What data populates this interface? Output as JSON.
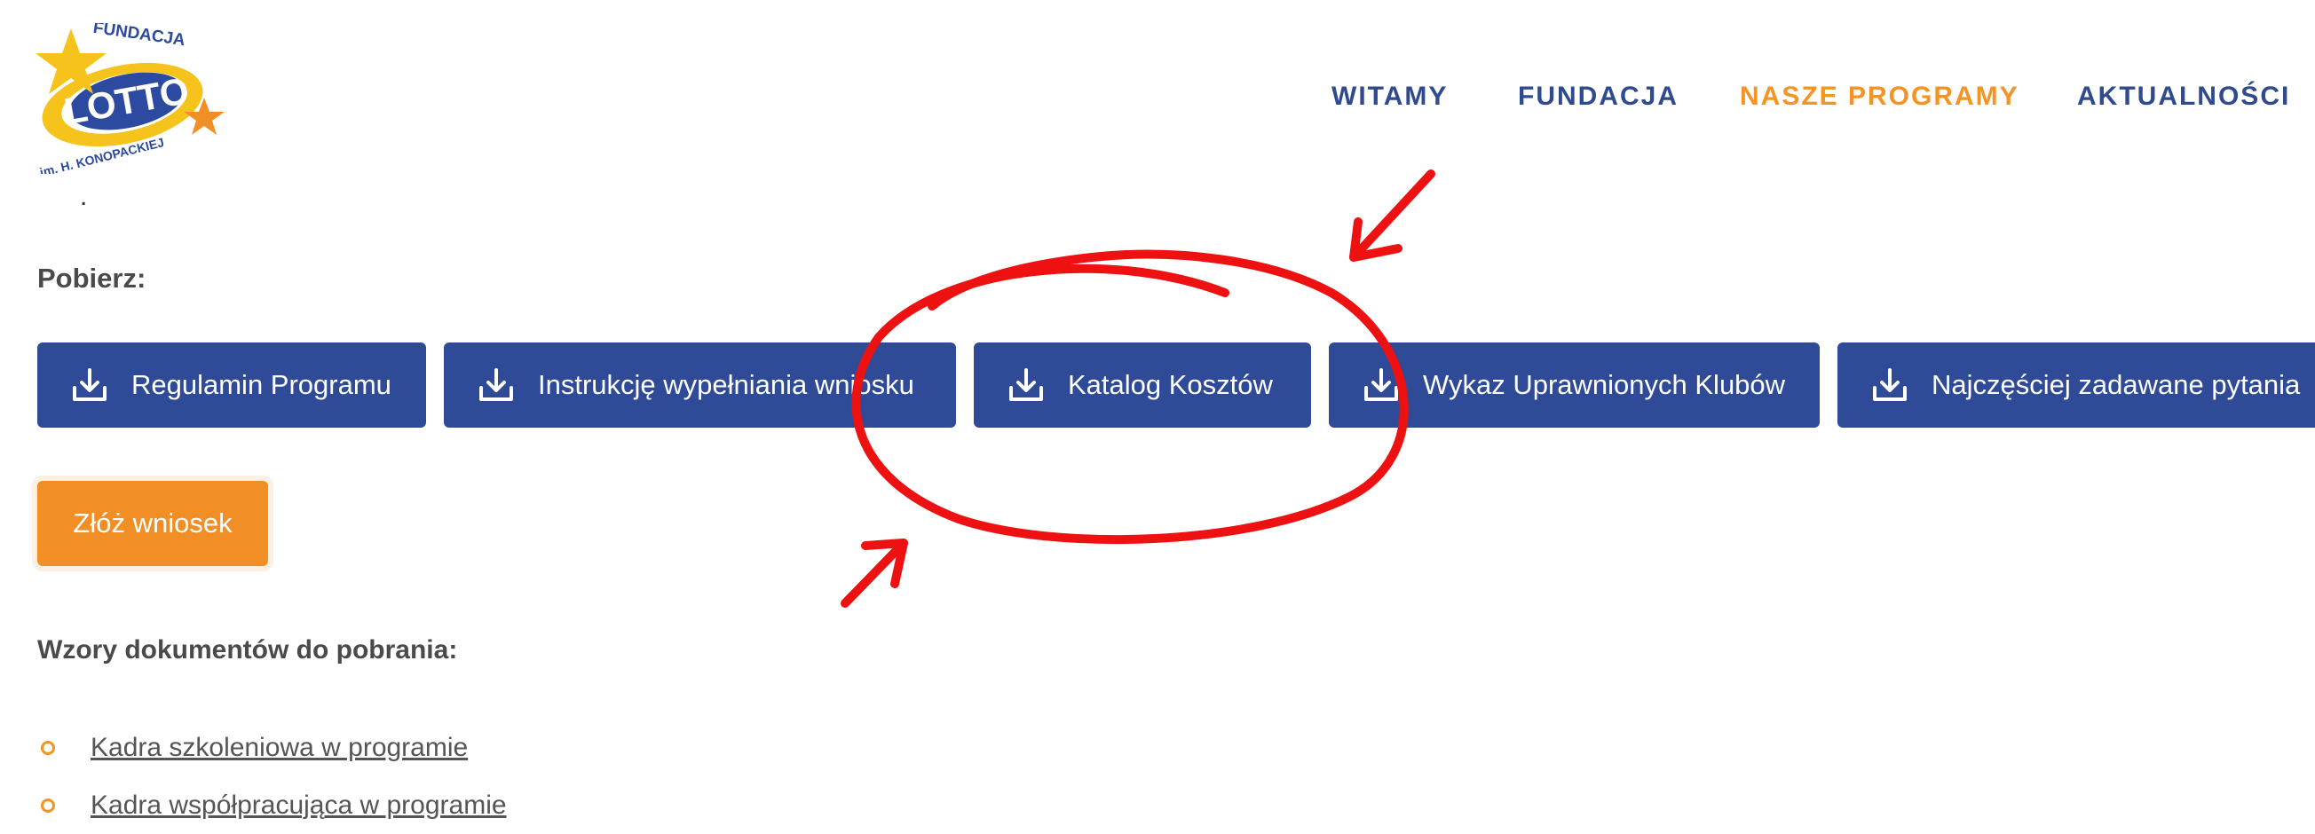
{
  "logo": {
    "text_top": "FUNDACJA",
    "text_main": "LOTTO",
    "text_bottom": "im. H. KONOPACKIEJ"
  },
  "nav": {
    "items": [
      {
        "label": "WITAMY",
        "active": false
      },
      {
        "label": "FUNDACJA",
        "active": false
      },
      {
        "label": "NASZE PROGRAMY",
        "active": true
      },
      {
        "label": "AKTUALNOŚCI",
        "active": false
      }
    ]
  },
  "list_dot": ".",
  "download_heading": "Pobierz:",
  "download_buttons": [
    {
      "label": "Regulamin Programu",
      "icon": "download-icon"
    },
    {
      "label": "Instrukcję wypełniania wniosku",
      "icon": "download-icon"
    },
    {
      "label": "Katalog Kosztów",
      "icon": "download-icon"
    },
    {
      "label": "Wykaz Uprawnionych Klubów",
      "icon": "download-icon"
    },
    {
      "label": "Najczęściej zadawane pytania",
      "icon": "download-icon"
    }
  ],
  "cta_label": "Złóż wniosek",
  "templates_heading": "Wzory dokumentów do pobrania:",
  "templates": [
    {
      "label": "Kadra szkoleniowa w programie"
    },
    {
      "label": "Kadra współpracująca w programie"
    }
  ],
  "colors": {
    "brand_blue": "#2f4a96",
    "accent_orange": "#f39424",
    "annotation_red": "#ee1111"
  }
}
